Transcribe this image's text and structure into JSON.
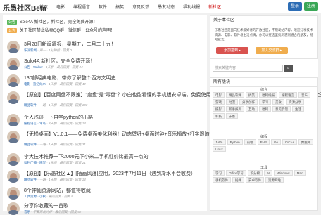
{
  "header": {
    "logo": "乐愚社区Beta",
    "nav": [
      "首页",
      "电影",
      "编程语言",
      "软件",
      "搞笑",
      "意见反馈",
      "愚友动态",
      "福利线报",
      "新社区"
    ],
    "login": "登录",
    "register": "注册"
  },
  "notices": [
    {
      "tag": "公告",
      "text": "Solo4A 新社区，新社区，完全免费开源！"
    },
    {
      "tag": "公告",
      "text": "关于社区禁止私卖QQ群，微信群，公众号的声明！"
    }
  ],
  "posts": [
    {
      "title": "3月28日新闻简报，星期五，二月二十九！",
      "meta": [
        "乐派新闻",
        "周一 · 1分钟前 · 回复 0"
      ]
    },
    {
      "title": "Solo4A 新社区，完全免费开源！",
      "meta": [
        "公告 · Walker",
        "1天前 · 最后回复 · 回复 24"
      ]
    },
    {
      "title": "130部经典电影，带你了解整个西方文明史",
      "meta": [
        "电影 · 追忆似水",
        "1天前 · 最后回复 · 回复 42"
      ]
    },
    {
      "title": "【原创】【百度网盘不限速】\"度盘\"是\"毒盘\"？小白也能看懂的手机版安卓端，免费使用不需要会员，让你永久不用再羡慕超级会员 (≧∇≦)",
      "meta": [
        "精品软件",
        "一路",
        "1天前 · 最后回复 · 回复 103"
      ]
    },
    {
      "title": "个人浅谈一下自学python的出路",
      "meta": [
        "编程语言 · 笨鸟",
        "3天前 · 最后回复 · 回复 14"
      ]
    },
    {
      "title": "【无损桌面】V1.0.1——免费桌面美化利器！动态壁纸+桌面时钟+音乐播放+打字跟随+鼠标特效",
      "meta": [
        "精品软件",
        "一路",
        "1天前 · 最后回复 · 回复 31"
      ]
    },
    {
      "title": "李大技术推荐一下2000元下小米二手机性价比最高一点的",
      "meta": [
        "福利广播 · 晚写",
        "1天前 · 最后回复 · 回复 21"
      ]
    },
    {
      "title": "【原创】【乐愚社区▲】[插画风漫]应用，2023年7月11日（遇到冷水不会收费）",
      "meta": [
        "精品软件",
        "一路",
        "1天前 · 最后回复 · 回复 14"
      ]
    },
    {
      "title": "8个神仙资源网站，都值得收藏",
      "meta": [
        "工具资源 · 小秋",
        "最后回复 · 回复 8"
      ]
    },
    {
      "title": "分享你收藏的一首歌",
      "meta": [
        "音乐",
        "不要再说的好",
        "最后回复 · 回复 52"
      ]
    }
  ],
  "sidebar": {
    "about_title": "关于本社区",
    "about_text": "乐愚社区是面向技术爱好者的开放社区，不限发帖内容，欢迎分享技术资源、电影、软件与生活点滴，你可以在这里找到志同道合的朋友，畅所欲言。",
    "btn1": "添加签到 ▸",
    "btn2": "加入交流群 ▸",
    "search_placeholder": "搜索关键内容",
    "sections": [
      {
        "title": "所有版块",
        "chips": []
      },
      {
        "title": "一 综合 一",
        "chips": [
          "电影",
          "精品软件",
          "搞笑",
          "福利线报",
          "编程语言",
          "音乐",
          "游戏",
          "动漫",
          "分享创作",
          "学习",
          "美食",
          "资源分享",
          "摄影",
          "新手报到",
          "互助",
          "福利",
          "意见反馈",
          "生活",
          "科技",
          "乐愚"
        ]
      },
      {
        "title": "一 编程 一",
        "chips": [
          "JAVA",
          "Python",
          "前端",
          "PHP",
          "Go",
          "C/C++",
          "数据库",
          "Linux"
        ]
      },
      {
        "title": "一 工具 一",
        "chips": [
          "学习",
          "Office学习",
          "积分榜",
          "AI",
          "Windows",
          "Mac",
          "手机软件",
          "插件",
          "安卓软件",
          "资源网站"
        ]
      }
    ]
  }
}
